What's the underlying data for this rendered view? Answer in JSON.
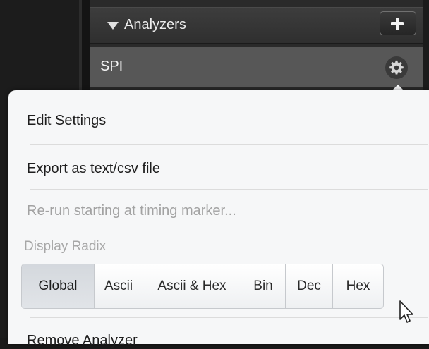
{
  "panel": {
    "title": "Analyzers",
    "collapse_icon": "triangle-down-icon",
    "add_icon": "plus-icon"
  },
  "analyzer": {
    "name": "SPI",
    "settings_icon": "gear-icon"
  },
  "menu": {
    "edit_settings": "Edit Settings",
    "export": "Export as text/csv file",
    "rerun": "Re-run starting at timing marker...",
    "display_radix_label": "Display Radix",
    "remove": "Remove Analyzer"
  },
  "radix": {
    "selected": "Global",
    "options": [
      "Global",
      "Ascii",
      "Ascii & Hex",
      "Bin",
      "Dec",
      "Hex"
    ]
  },
  "colors": {
    "panel_bg": "#2a2a2a",
    "row_bg": "#575757",
    "menu_bg": "#f6f7f8",
    "disabled_text": "#a2a2a2"
  }
}
